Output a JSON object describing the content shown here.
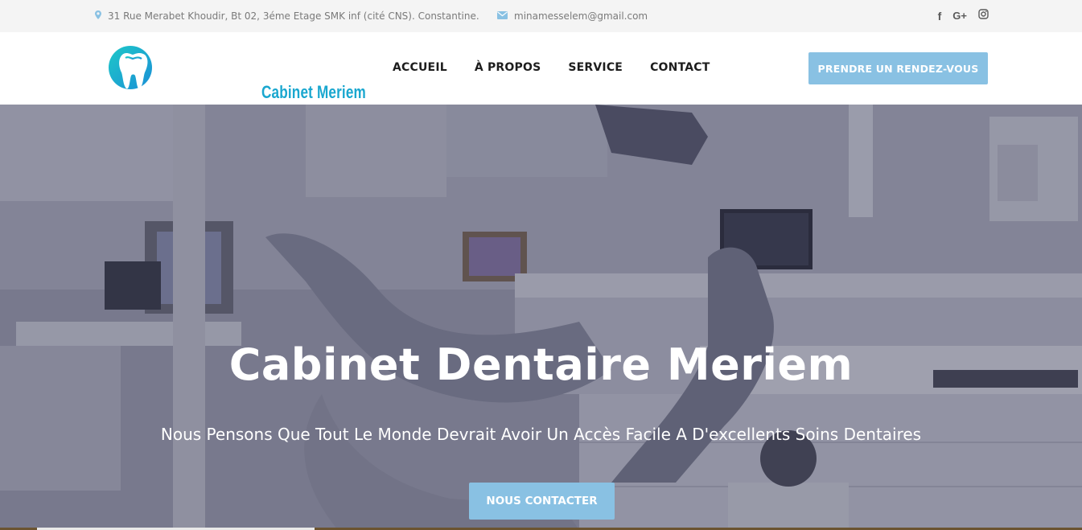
{
  "topbar": {
    "address": "31 Rue Merabet Khoudir, Bt 02, 3éme Etage SMK inf (cité CNS). Constantine.",
    "email": "minamesselem@gmail.com",
    "social": {
      "facebook": "f",
      "google": "G+",
      "instagram": "◎"
    },
    "icons": [
      "map-pin-icon",
      "envelope-icon",
      "facebook-icon",
      "google-plus-icon",
      "instagram-icon"
    ]
  },
  "header": {
    "logo_text": "Cabinet Meriem",
    "nav": [
      "ACCUEIL",
      "À PROPOS",
      "SERVICE",
      "CONTACT"
    ],
    "cta": "PRENDRE UN RENDEZ-VOUS"
  },
  "hero": {
    "title": "Cabinet Dentaire Meriem",
    "subtitle": "Nous Pensons Que Tout Le Monde Devrait Avoir Un Accès Facile A D'excellents Soins Dentaires",
    "cta": "NOUS CONTACTER"
  },
  "colors": {
    "accent": "#89c1e3",
    "logo_gradient_start": "#1ec8c8",
    "logo_gradient_end": "#1a8fd6",
    "topbar_bg": "#f4f4f4",
    "nav_text": "#1d1d1d"
  }
}
